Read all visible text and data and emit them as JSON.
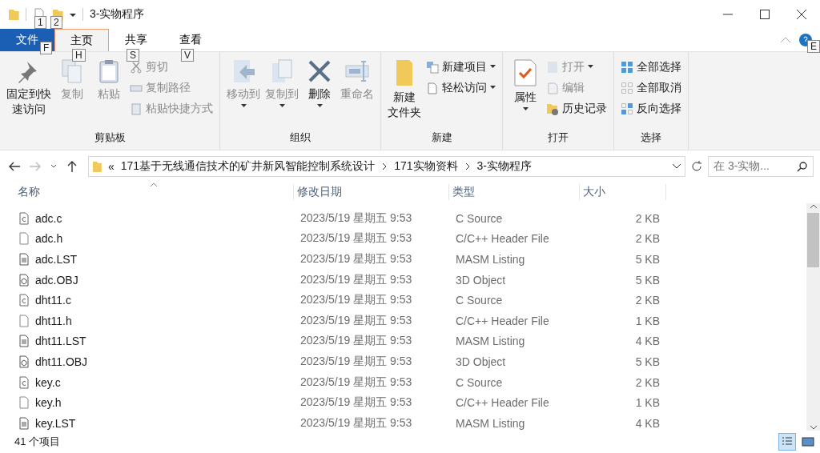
{
  "title_bar": {
    "title": "3-实物程序",
    "quick_access_key_tips": [
      "1",
      "2"
    ]
  },
  "ribbon_tabs": [
    {
      "label": "文件",
      "kind": "file",
      "selected": false,
      "key_tip": "F"
    },
    {
      "label": "主页",
      "kind": "tab",
      "selected": true,
      "key_tip": "H"
    },
    {
      "label": "共享",
      "kind": "tab",
      "selected": false,
      "key_tip": "S"
    },
    {
      "label": "查看",
      "kind": "tab",
      "selected": false,
      "key_tip": "V"
    }
  ],
  "help_key_tip": "E",
  "ribbon_groups": [
    {
      "name": "剪贴板",
      "items": [
        {
          "label": [
            "固定到快",
            "速访问"
          ],
          "kind": "large",
          "enabled": true,
          "dropdown": false
        },
        {
          "label": "复制",
          "kind": "large",
          "enabled": false,
          "dropdown": false
        },
        {
          "label": "粘贴",
          "kind": "large",
          "enabled": false,
          "dropdown": false
        },
        {
          "label": "剪切",
          "kind": "small",
          "enabled": false,
          "dropdown": false
        },
        {
          "label": "复制路径",
          "kind": "small",
          "enabled": false,
          "dropdown": false
        },
        {
          "label": "粘贴快捷方式",
          "kind": "small",
          "enabled": false,
          "dropdown": false
        }
      ]
    },
    {
      "name": "组织",
      "items": [
        {
          "label": "移动到",
          "kind": "large",
          "enabled": false,
          "dropdown": true
        },
        {
          "label": "复制到",
          "kind": "large",
          "enabled": false,
          "dropdown": true
        },
        {
          "label": "删除",
          "kind": "large",
          "enabled": true,
          "dropdown": true
        },
        {
          "label": "重命名",
          "kind": "large",
          "enabled": false,
          "dropdown": false
        }
      ]
    },
    {
      "name": "新建",
      "items": [
        {
          "label": [
            "新建",
            "文件夹"
          ],
          "kind": "large",
          "enabled": true,
          "dropdown": false
        },
        {
          "label": "新建项目",
          "kind": "small",
          "enabled": true,
          "dropdown": true
        },
        {
          "label": "轻松访问",
          "kind": "small",
          "enabled": true,
          "dropdown": true
        }
      ]
    },
    {
      "name": "打开",
      "items": [
        {
          "label": "属性",
          "kind": "large",
          "enabled": true,
          "dropdown": true
        },
        {
          "label": "打开",
          "kind": "small",
          "enabled": false,
          "dropdown": true
        },
        {
          "label": "编辑",
          "kind": "small",
          "enabled": false,
          "dropdown": false
        },
        {
          "label": "历史记录",
          "kind": "small",
          "enabled": true,
          "dropdown": false
        }
      ]
    },
    {
      "name": "选择",
      "items": [
        {
          "label": "全部选择",
          "kind": "small",
          "enabled": true,
          "dropdown": false
        },
        {
          "label": "全部取消",
          "kind": "small",
          "enabled": true,
          "dropdown": false
        },
        {
          "label": "反向选择",
          "kind": "small",
          "enabled": true,
          "dropdown": false
        }
      ]
    }
  ],
  "address_bar": {
    "overflow": "«",
    "path": [
      "171基于无线通信技术的矿井新风智能控制系统设计",
      "171实物资料",
      "3-实物程序"
    ]
  },
  "search": {
    "placeholder": "在 3-实物..."
  },
  "columns": [
    {
      "label": "名称",
      "sorted": true
    },
    {
      "label": "修改日期",
      "sorted": false
    },
    {
      "label": "类型",
      "sorted": false
    },
    {
      "label": "大小",
      "sorted": false
    }
  ],
  "rows": [
    {
      "name": "adc.c",
      "kind": "c",
      "date": "2023/5/19 星期五 9:53",
      "type": "C Source",
      "size": "2 KB"
    },
    {
      "name": "adc.h",
      "kind": "h",
      "date": "2023/5/19 星期五 9:53",
      "type": "C/C++ Header File",
      "size": "2 KB"
    },
    {
      "name": "adc.LST",
      "kind": "lst",
      "date": "2023/5/19 星期五 9:53",
      "type": "MASM Listing",
      "size": "5 KB"
    },
    {
      "name": "adc.OBJ",
      "kind": "obj",
      "date": "2023/5/19 星期五 9:53",
      "type": "3D Object",
      "size": "5 KB"
    },
    {
      "name": "dht11.c",
      "kind": "c",
      "date": "2023/5/19 星期五 9:53",
      "type": "C Source",
      "size": "2 KB"
    },
    {
      "name": "dht11.h",
      "kind": "h",
      "date": "2023/5/19 星期五 9:53",
      "type": "C/C++ Header File",
      "size": "1 KB"
    },
    {
      "name": "dht11.LST",
      "kind": "lst",
      "date": "2023/5/19 星期五 9:53",
      "type": "MASM Listing",
      "size": "4 KB"
    },
    {
      "name": "dht11.OBJ",
      "kind": "obj",
      "date": "2023/5/19 星期五 9:53",
      "type": "3D Object",
      "size": "5 KB"
    },
    {
      "name": "key.c",
      "kind": "c",
      "date": "2023/5/19 星期五 9:53",
      "type": "C Source",
      "size": "2 KB"
    },
    {
      "name": "key.h",
      "kind": "h",
      "date": "2023/5/19 星期五 9:53",
      "type": "C/C++ Header File",
      "size": "1 KB"
    },
    {
      "name": "key.LST",
      "kind": "lst",
      "date": "2023/5/19 星期五 9:53",
      "type": "MASM Listing",
      "size": "4 KB"
    }
  ],
  "status_bar": {
    "item_count": "41 个项目"
  }
}
